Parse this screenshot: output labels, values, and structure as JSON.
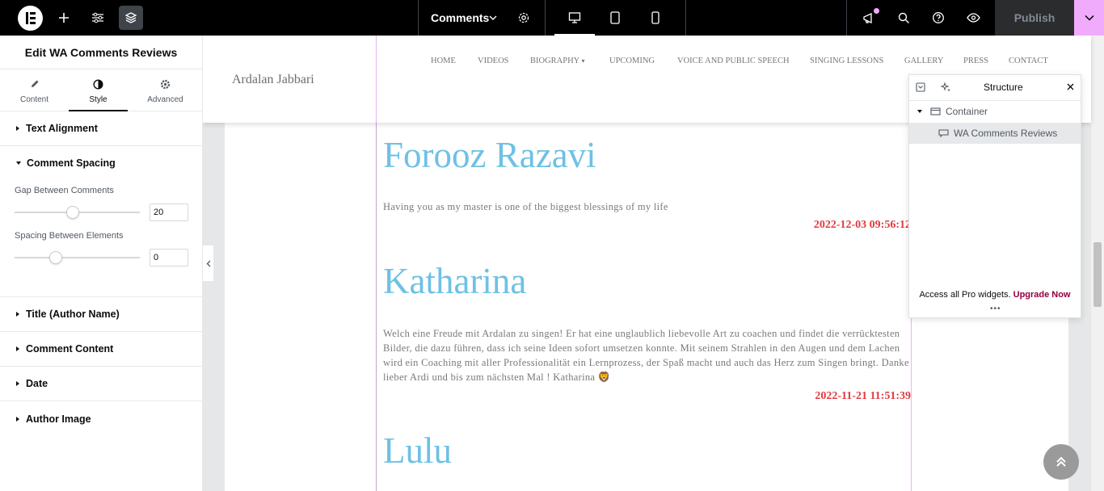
{
  "topbar": {
    "document_title": "Comments",
    "publish_label": "Publish"
  },
  "panel": {
    "title": "Edit WA Comments Reviews",
    "tabs": [
      {
        "label": "Content",
        "icon": "pencil-icon"
      },
      {
        "label": "Style",
        "icon": "contrast-icon"
      },
      {
        "label": "Advanced",
        "icon": "gear-icon"
      }
    ],
    "sections": {
      "text_alignment": "Text Alignment",
      "comment_spacing": "Comment Spacing",
      "title_author": "Title (Author Name)",
      "comment_content": "Comment Content",
      "date": "Date",
      "author_image": "Author Image"
    },
    "controls": {
      "gap_label": "Gap Between Comments",
      "gap_value": "20",
      "spacing_label": "Spacing Between Elements",
      "spacing_value": "0"
    }
  },
  "site": {
    "logo": "Ardalan Jabbari",
    "nav": [
      "HOME",
      "VIDEOS",
      "BIOGRAPHY",
      "UPCOMING",
      "VOICE AND PUBLIC SPEECH",
      "SINGING LESSONS",
      "GALLERY",
      "PRESS",
      "CONTACT"
    ]
  },
  "comments": [
    {
      "author": "Forooz Razavi",
      "text": "Having you as my master is one of the biggest blessings of my life",
      "date": "2022-12-03 09:56:12"
    },
    {
      "author": "Katharina",
      "text": "Welch eine Freude mit Ardalan zu singen! Er hat eine unglaublich liebevolle Art zu coachen und findet die verrücktesten Bilder, die dazu führen, dass ich seine Ideen sofort umsetzen konnte. Mit seinem Strahlen in den Augen und dem Lachen wird ein Coaching mit aller Professionalität ein Lernprozess, der Spaß macht und auch das Herz zum Singen bringt. Danke lieber Ardi und bis zum nächsten Mal ! Katharina 🦁",
      "date": "2022-11-21 11:51:39"
    },
    {
      "author": "Lulu",
      "text": "",
      "date": ""
    }
  ],
  "structure": {
    "title": "Structure",
    "items": [
      "Container",
      "WA Comments Reviews"
    ],
    "footer_text": "Access all Pro widgets.",
    "footer_link": "Upgrade Now"
  }
}
